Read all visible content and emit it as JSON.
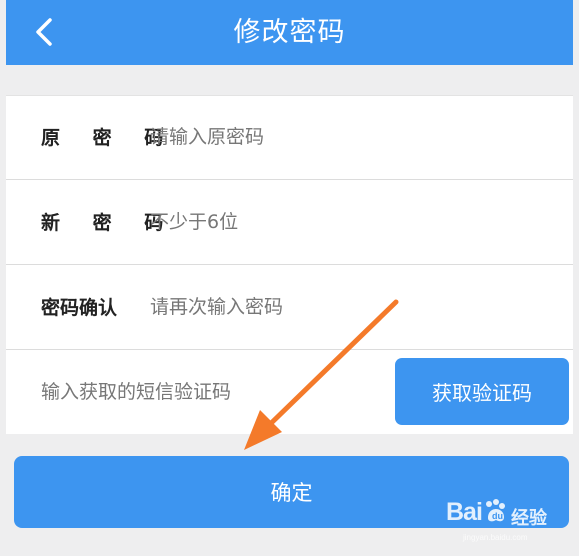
{
  "header": {
    "title": "修改密码",
    "back_icon": "chevron-left-icon"
  },
  "form": {
    "original_password": {
      "label": "原 密 码",
      "placeholder": "请输入原密码",
      "value": ""
    },
    "new_password": {
      "label": "新 密 码",
      "placeholder": "不少于6位",
      "value": ""
    },
    "confirm_password": {
      "label": "密码确认",
      "placeholder": "请再次输入密码",
      "value": ""
    },
    "sms_code": {
      "placeholder": "输入获取的短信验证码",
      "value": "",
      "button_label": "获取验证码"
    }
  },
  "actions": {
    "confirm_label": "确定"
  },
  "overlay": {
    "arrow_icon": "orange-arrow-icon"
  },
  "watermark": {
    "brand": "Bai",
    "brand_suffix": "du",
    "label": "经验",
    "url": "jingyan.baidu.com"
  },
  "colors": {
    "primary": "#3d95f0",
    "background": "#eeeeef",
    "arrow": "#f47a2a"
  }
}
